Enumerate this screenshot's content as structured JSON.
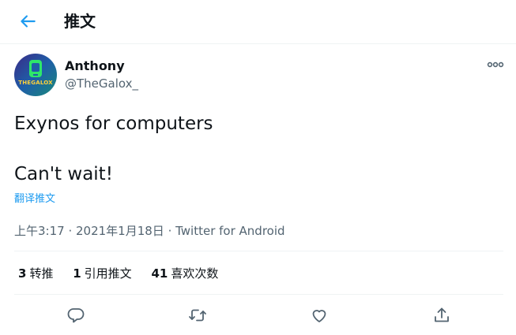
{
  "header": {
    "title": "推文",
    "back_icon": "arrow-left-icon"
  },
  "author": {
    "name": "Anthony",
    "handle": "@TheGalox_",
    "avatar_text": "THEGALOX"
  },
  "tweet": {
    "line1": "Exynos for computers",
    "line2": "Can't wait!",
    "translate": "翻译推文",
    "time": "上午3:17 · 2021年1月18日",
    "sep": " · ",
    "source": "Twitter for Android"
  },
  "stats": {
    "retweets": {
      "count": "3",
      "label": "转推"
    },
    "quotes": {
      "count": "1",
      "label": "引用推文"
    },
    "likes": {
      "count": "41",
      "label": "喜欢次数"
    }
  },
  "actions": [
    "reply-icon",
    "retweet-icon",
    "like-icon",
    "share-icon"
  ],
  "colors": {
    "accent": "#1d9bf0",
    "text": "#0f1419",
    "secondary": "#536471",
    "border": "#eff3f4"
  }
}
